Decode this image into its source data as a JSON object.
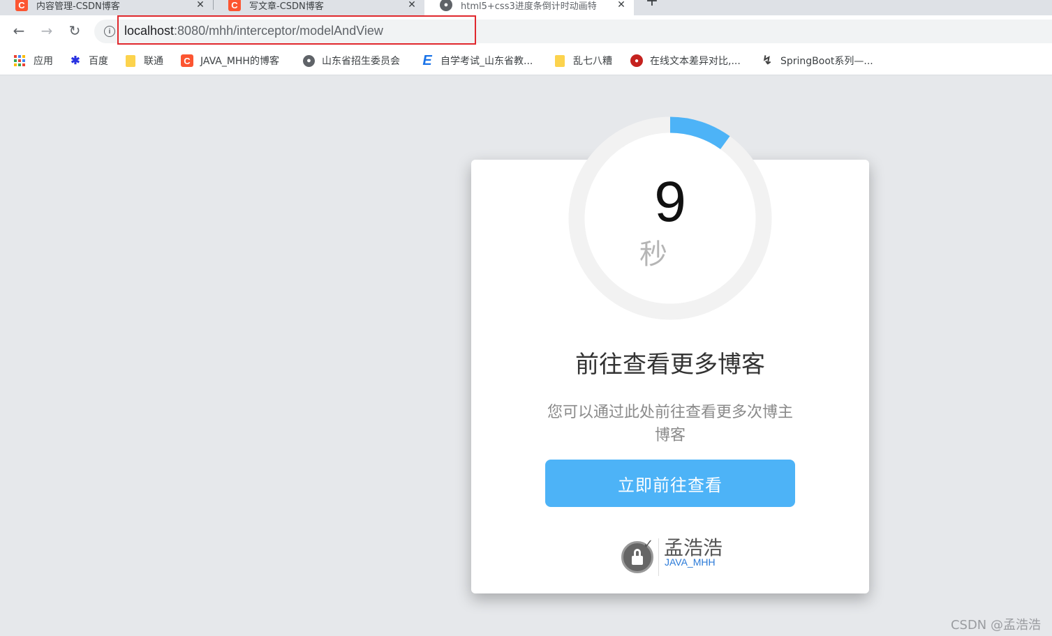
{
  "browser": {
    "tabs": [
      {
        "title": "内容管理-CSDN博客",
        "favicon": "C"
      },
      {
        "title": "写文章-CSDN博客",
        "favicon": "C"
      },
      {
        "title": "html5+css3进度条倒计时动画特",
        "favicon": "globe"
      }
    ],
    "new_tab_label": "+",
    "close_label": "✕",
    "url_host": "localhost",
    "url_rest": ":8080/mhh/interceptor/modelAndView",
    "bookmarks": [
      {
        "label": "应用",
        "icon": "apps-icon"
      },
      {
        "label": "百度",
        "icon": "baidu-paw-icon"
      },
      {
        "label": "联通",
        "icon": "folder-icon"
      },
      {
        "label": "JAVA_MHH的博客",
        "icon": "csdn-icon"
      },
      {
        "label": "山东省招生委员会",
        "icon": "globe-icon"
      },
      {
        "label": "自学考试_山东省教...",
        "icon": "e-icon"
      },
      {
        "label": "乱七八糟",
        "icon": "folder-icon"
      },
      {
        "label": "在线文本差异对比,...",
        "icon": "red-circle-icon"
      },
      {
        "label": "SpringBoot系列—...",
        "icon": "spring-icon"
      }
    ]
  },
  "countdown": {
    "value": "9",
    "unit": "秒",
    "progress": 0.1,
    "track_color": "#f2f2f2",
    "progress_color": "#4db3f7"
  },
  "card": {
    "heading": "前往查看更多博客",
    "description": "您可以通过此处前往查看更多次博主博客",
    "button_label": "立即前往查看"
  },
  "logo": {
    "name": "孟浩浩",
    "subtitle": "JAVA_MHH"
  },
  "watermark": "CSDN @孟浩浩",
  "colors": {
    "accent": "#4db3f7",
    "page_bg": "#e6e8eb",
    "highlight_box": "#e0282d"
  }
}
